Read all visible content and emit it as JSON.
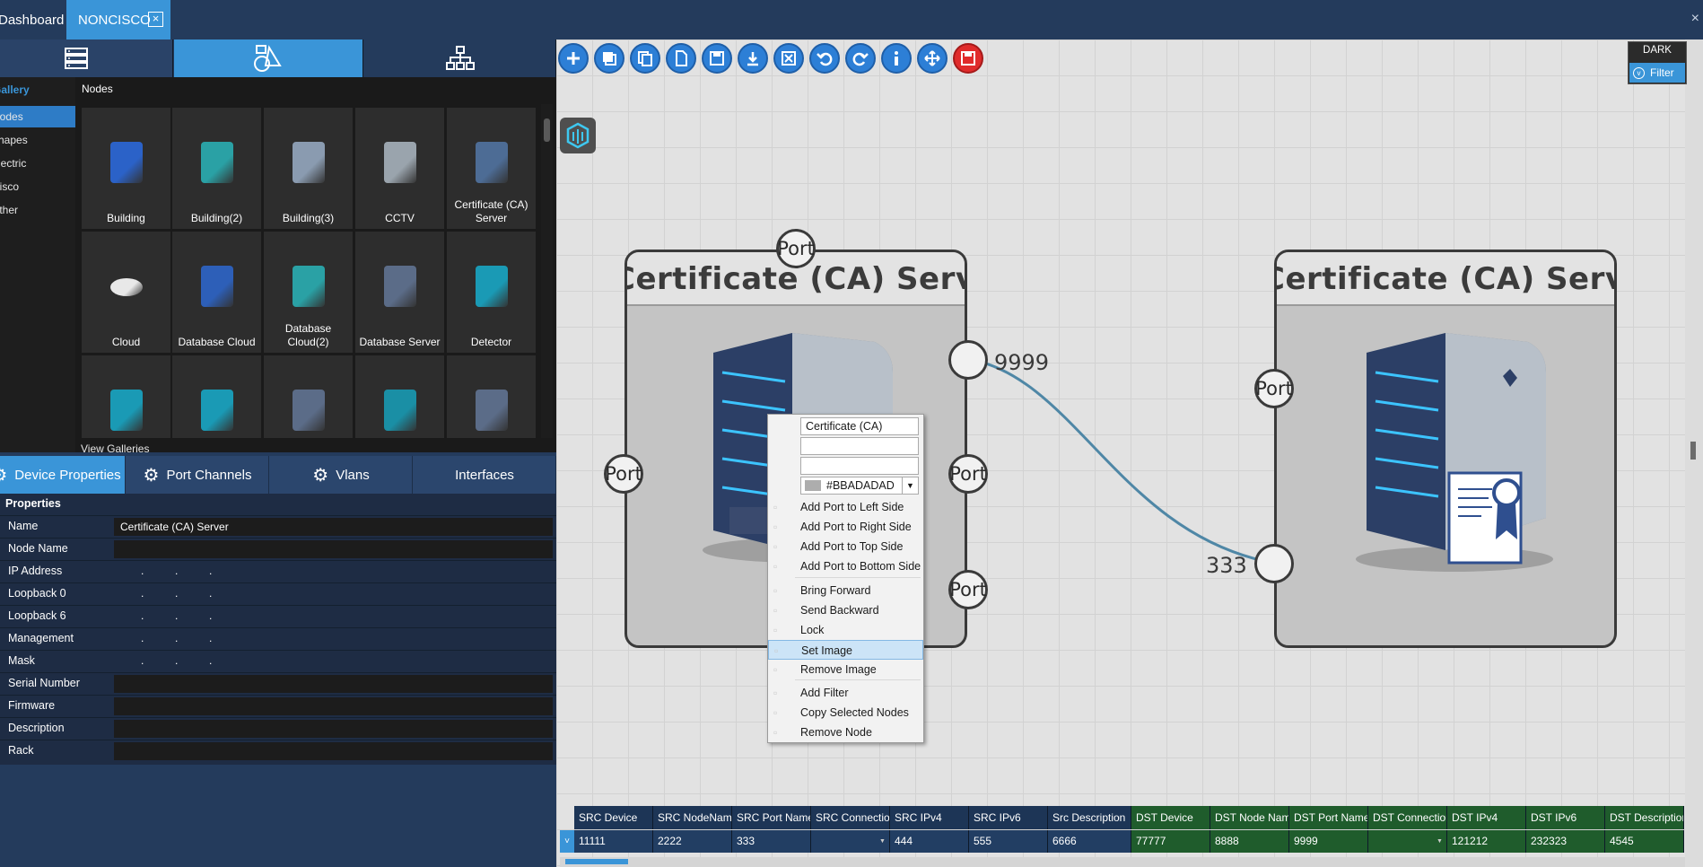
{
  "tabs": {
    "dashboard": "Dashboard",
    "noncisco": "NONCISCO",
    "close_glyph": "×"
  },
  "gallery": {
    "categories": [
      "Gallery",
      "Nodes",
      "Shapes",
      "Electric",
      "Cisco",
      "Other"
    ],
    "title": "Nodes",
    "items": [
      "Building",
      "Building(2)",
      "Building(3)",
      "CCTV",
      "Certificate (CA) Server",
      "Cloud",
      "Database Cloud",
      "Database Cloud(2)",
      "Database Server",
      "Detector",
      "",
      "",
      "",
      "",
      ""
    ],
    "view_link": "View Galleries"
  },
  "device_tabs": [
    "Device Properties",
    "Port Channels",
    "Vlans",
    "Interfaces"
  ],
  "properties": {
    "title": "Properties",
    "rows": [
      {
        "key": "Name",
        "value": "Certificate (CA) Server"
      },
      {
        "key": "Node Name",
        "value": ""
      },
      {
        "key": "IP Address",
        "value": ""
      },
      {
        "key": "Loopback 0",
        "value": ""
      },
      {
        "key": "Loopback 6",
        "value": ""
      },
      {
        "key": "Management",
        "value": ""
      },
      {
        "key": "Mask",
        "value": ""
      },
      {
        "key": "Serial Number",
        "value": ""
      },
      {
        "key": "Firmware",
        "value": ""
      },
      {
        "key": "Description",
        "value": ""
      },
      {
        "key": "Rack",
        "value": ""
      }
    ]
  },
  "toolbar": {
    "icons": [
      "add-icon",
      "stack-icon",
      "copy-icon",
      "new-page-icon",
      "save-icon",
      "download-icon",
      "excel-icon",
      "undo-icon",
      "redo-icon",
      "info-icon",
      "move-icon",
      "save-red-icon"
    ]
  },
  "theme": {
    "dark_label": "DARK",
    "filter_label": "Filter"
  },
  "canvas": {
    "node1": {
      "title": "Certificate (CA) Server",
      "port_top": "Port",
      "port_left": "Port",
      "port_right1": "Port",
      "port_right2": "Port",
      "port_label": "9999"
    },
    "node2": {
      "title": "Certificate (CA) Server",
      "port_left": "Port",
      "port_label": "333"
    }
  },
  "context_menu": {
    "name_value": "Certificate (CA) Server",
    "color_value": "#BBADADAD",
    "items": [
      "Add Port to Left Side",
      "Add Port to Right Side",
      "Add Port to Top Side",
      "Add Port to Bottom Side",
      "Bring Forward",
      "Send Backward",
      "Lock",
      "Set Image",
      "Remove Image",
      "Add Filter",
      "Copy Selected Nodes",
      "Remove Node"
    ]
  },
  "link_grid": {
    "headers": [
      "SRC Device",
      "SRC NodeName",
      "SRC Port Name",
      "SRC Connection",
      "SRC IPv4",
      "SRC IPv6",
      "Src Description",
      "DST Device",
      "DST Node Name",
      "DST Port Name",
      "DST Connection",
      "DST IPv4",
      "DST IPv6",
      "DST Description"
    ],
    "row": [
      "11111",
      "2222",
      "333",
      "",
      "444",
      "555",
      "6666",
      "77777",
      "8888",
      "9999",
      "",
      "121212",
      "232323",
      "4545"
    ]
  },
  "colors": {
    "accent": "#3a95d8",
    "src": "#223e63",
    "dst": "#1f5c2c",
    "link": "#4f87a6"
  }
}
